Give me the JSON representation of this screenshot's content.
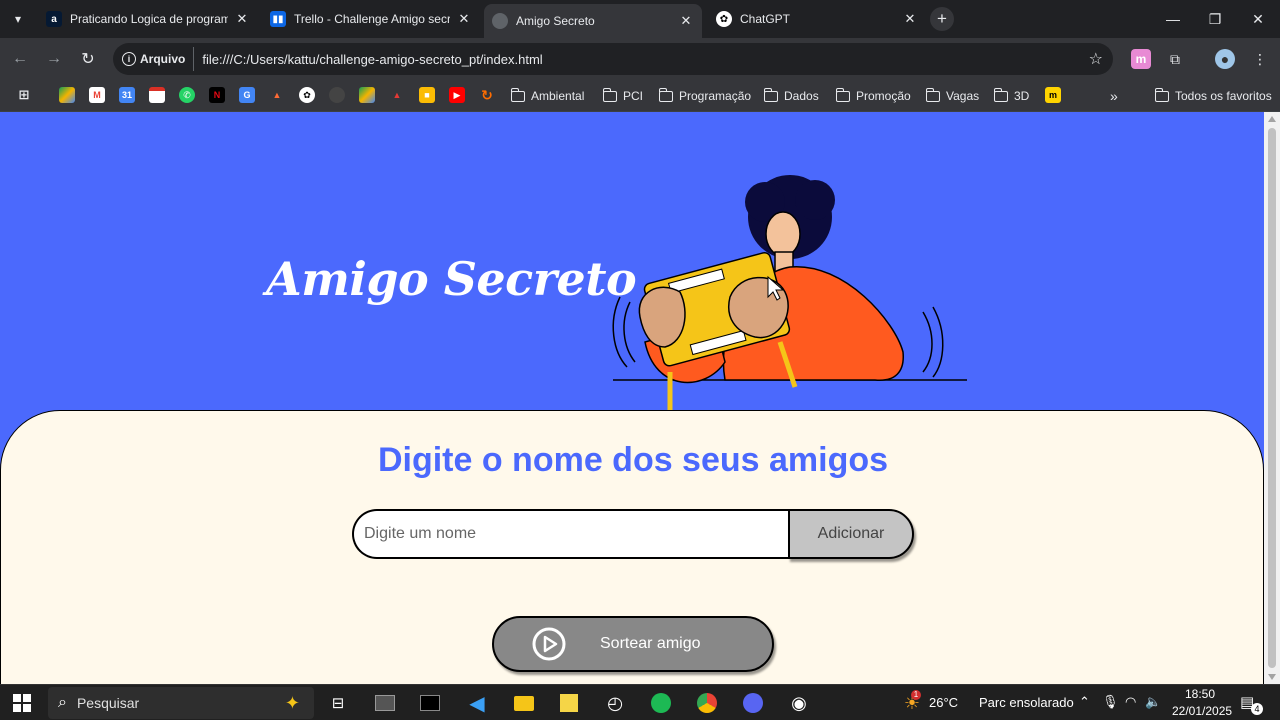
{
  "browser": {
    "tabs": [
      {
        "title": "Praticando Logica de programa",
        "icon": "alura-icon",
        "active": false
      },
      {
        "title": "Trello - Challenge Amigo secret",
        "icon": "trello-icon",
        "active": false
      },
      {
        "title": "Amigo Secreto",
        "icon": "globe-icon",
        "active": true
      },
      {
        "title": "ChatGPT",
        "icon": "chatgpt-icon",
        "active": false
      }
    ],
    "omnibox": {
      "chip_label": "Arquivo",
      "url": "file:///C:/Users/kattu/challenge-amigo-secreto_pt/index.html"
    },
    "bookmarks": {
      "folders": [
        "Ambiental",
        "PCI",
        "Programação",
        "Dados",
        "Promoção",
        "Vagas",
        "3D"
      ],
      "overflow": "»",
      "all_label": "Todos os favoritos"
    }
  },
  "page": {
    "hero_title": "Amigo Secreto",
    "card_title": "Digite o nome dos seus amigos",
    "input_placeholder": "Digite um nome",
    "add_button": "Adicionar",
    "draw_button": "Sortear amigo",
    "colors": {
      "primary": "#4b69fd",
      "card_bg": "#fff9eb",
      "add_btn": "#c4c4c4",
      "draw_btn": "#888888"
    }
  },
  "taskbar": {
    "search_label": "Pesquisar",
    "weather_temp": "26°C",
    "weather_desc": "Parc ensolarado",
    "time": "18:50",
    "date": "22/01/2025",
    "notification_count": "4",
    "weather_badge": "1"
  }
}
